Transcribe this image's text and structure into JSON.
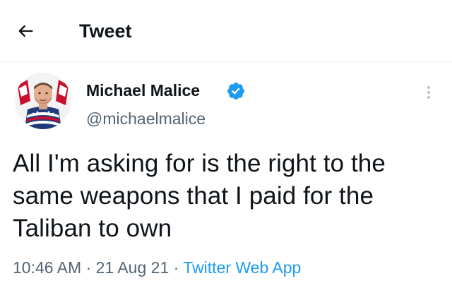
{
  "header": {
    "back_icon": "arrow-left-icon",
    "title": "Tweet"
  },
  "tweet": {
    "author": {
      "name": "Michael Malice",
      "handle": "@michaelmalice",
      "verified": true,
      "verified_icon": "verified-badge-icon",
      "verified_color": "#1d9bf0"
    },
    "more_icon": "more-vertical-icon",
    "text": "All I'm asking for is the right to the same weapons that I paid for the Taliban to own",
    "time": "10:46 AM",
    "separator": "·",
    "date": "21 Aug 21",
    "source": "Twitter Web App"
  },
  "colors": {
    "text_primary": "#0f1419",
    "text_secondary": "#536471",
    "accent": "#1d9bf0"
  }
}
